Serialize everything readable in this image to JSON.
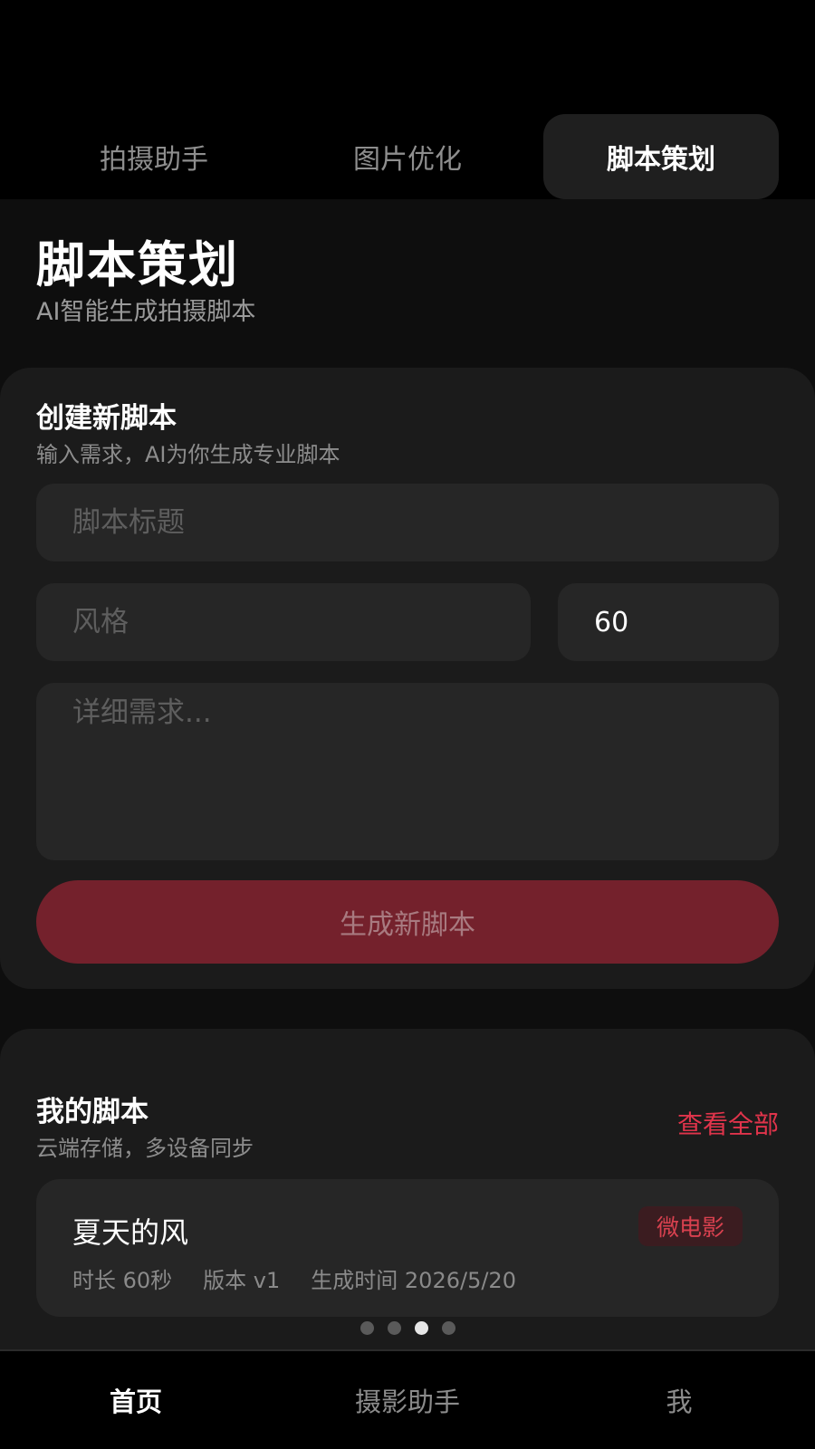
{
  "top_tabs": [
    {
      "label": "拍摄助手"
    },
    {
      "label": "图片优化"
    },
    {
      "label": "脚本策划"
    }
  ],
  "header": {
    "title": "脚本策划",
    "subtitle": "AI智能生成拍摄脚本"
  },
  "create_card": {
    "title": "创建新脚本",
    "subtitle": "输入需求，AI为你生成专业脚本",
    "title_placeholder": "脚本标题",
    "style_placeholder": "风格",
    "duration_value": "60",
    "detail_placeholder": "详细需求...",
    "generate_label": "生成新脚本"
  },
  "my_scripts": {
    "title": "我的脚本",
    "subtitle": "云端存储，多设备同步",
    "view_all_label": "查看全部",
    "items": [
      {
        "name": "夏天的风",
        "tag": "微电影",
        "duration": "时长 60秒",
        "version": "版本 v1",
        "created": "生成时间 2026/5/20"
      }
    ]
  },
  "pager": {
    "count": 4,
    "active_index": 2
  },
  "bottom_nav": [
    {
      "label": "首页"
    },
    {
      "label": "摄影助手"
    },
    {
      "label": "我"
    }
  ],
  "colors": {
    "accent": "#e0344b",
    "button_bg": "#74212c",
    "card_bg": "#1b1b1b",
    "field_bg": "#262626"
  }
}
